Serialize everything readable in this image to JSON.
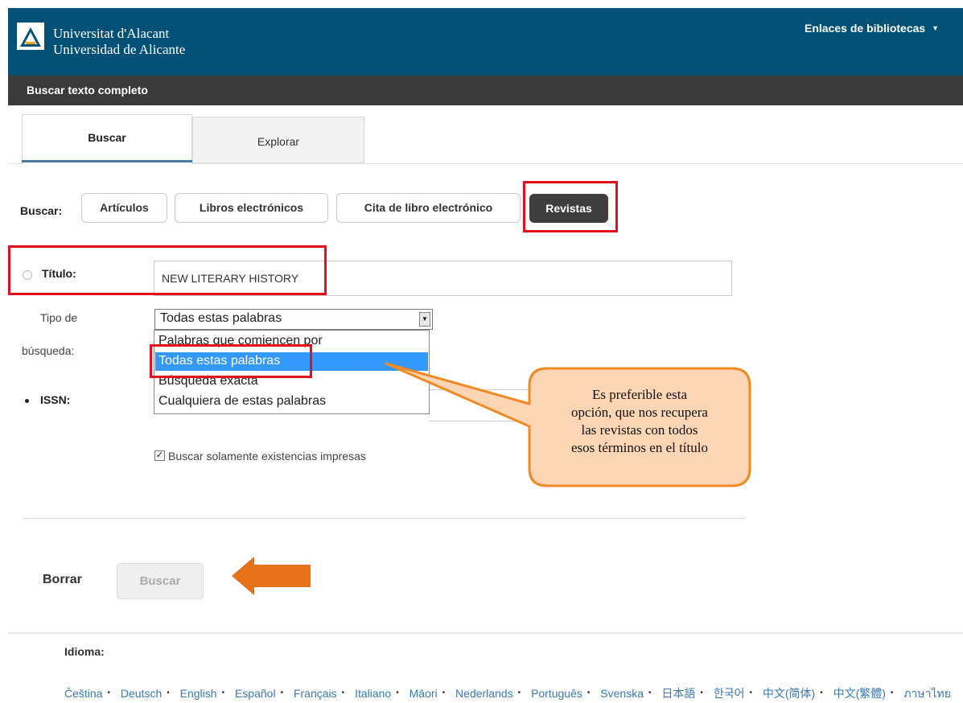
{
  "header": {
    "university_line1": "Universitat d'Alacant",
    "university_line2": "Universidad de Alicante",
    "links_menu": "Enlaces de bibliotecas"
  },
  "subheader": {
    "title": "Buscar texto completo"
  },
  "tabs": [
    {
      "label": "Buscar",
      "active": true
    },
    {
      "label": "Explorar",
      "active": false
    }
  ],
  "search_types": {
    "label": "Buscar:",
    "options": [
      "Artículos",
      "Libros electrónicos",
      "Cita de libro electrónico",
      "Revistas"
    ],
    "selected": "Revistas"
  },
  "title_field": {
    "label": "Título:",
    "value": "NEW LITERARY HISTORY"
  },
  "search_type": {
    "label_line1": "Tipo de",
    "label_line2": "búsqueda:",
    "selected": "Todas estas palabras",
    "options": [
      "Palabras que comiencen por",
      "Todas estas palabras",
      "Búsqueda exacta",
      "Cualquiera de estas palabras"
    ]
  },
  "issn_field": {
    "label": "ISSN:",
    "value": ""
  },
  "print_only": {
    "label": "Buscar solamente existencias impresas",
    "checked": true
  },
  "callout": {
    "line1": "Es preferible esta",
    "line2": "opción, que nos recupera",
    "line3": "las revistas con todos",
    "line4": "esos términos en el título"
  },
  "actions": {
    "clear_label": "Borrar",
    "search_label": "Buscar"
  },
  "footer": {
    "language_label": "Idioma:",
    "languages": [
      "Čeština",
      "Deutsch",
      "English",
      "Español",
      "Français",
      "Italiano",
      "Māori",
      "Nederlands",
      "Português",
      "Svenska",
      "日本語",
      "한국어",
      "中文(简体)",
      "中文(繁體)",
      "ภาษาไทย"
    ]
  },
  "colors": {
    "header_bg": "#045177",
    "subheader_bg": "#3a3a3a",
    "highlight_red": "#e4101b",
    "callout_fill": "#fcd5b4",
    "callout_border": "#f08a24",
    "arrow_orange": "#e8711b",
    "selected_option_bg": "#3399ff",
    "link_blue": "#3a7ab8"
  },
  "icons": {
    "logo": "university-logo-icon",
    "menu_caret": "caret-down-icon",
    "select_arrow": "chevron-down-icon",
    "checkbox": "checkmark-icon",
    "pointer": "arrow-left-icon"
  }
}
